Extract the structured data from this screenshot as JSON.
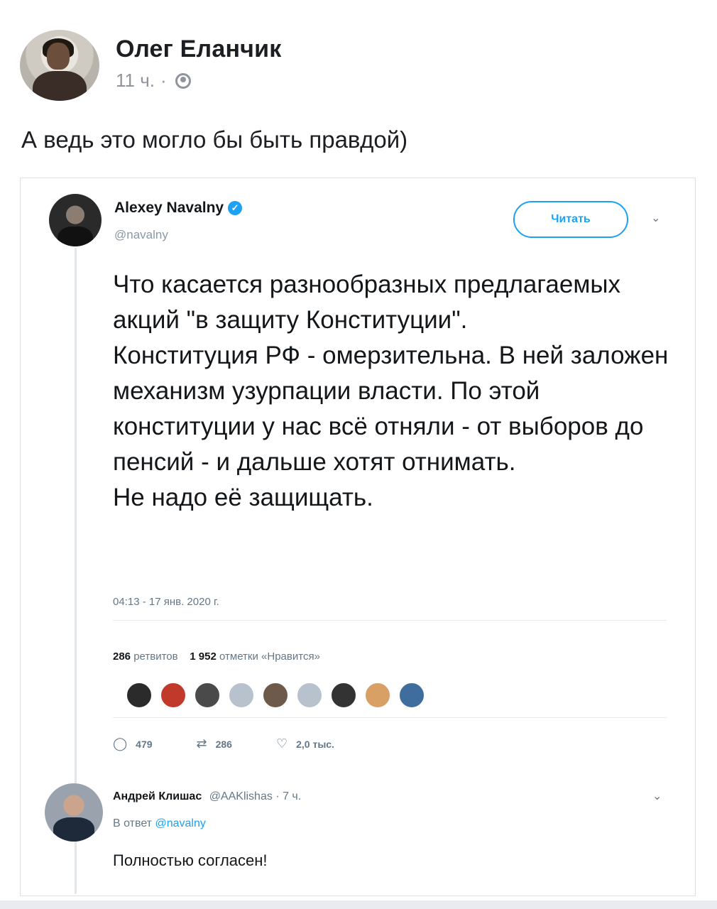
{
  "post": {
    "author": "Олег Еланчик",
    "time": "11 ч.",
    "separator": "·",
    "privacy_icon": "globe-icon",
    "text": "А ведь это могло бы быть правдой)"
  },
  "tweet": {
    "name": "Alexey Navalny",
    "verified_icon": "verified-badge-icon",
    "handle": "@navalny",
    "follow_label": "Читать",
    "caret": "⌄",
    "body": [
      "Что касается разнообразных предлагаемых акций \"в защиту Конституции\".",
      "Конституция РФ - омерзительна. В ней заложен механизм узурпации власти. По этой конституции у нас всё отняли - от выборов до пенсий - и дальше хотят отнимать.",
      "Не надо её защищать."
    ],
    "timestamp": "04:13 - 17 янв. 2020 г.",
    "retweets_count": "286",
    "retweets_label": "ретвитов",
    "likes_count": "1 952",
    "likes_label": "отметки «Нравится»",
    "actions": {
      "replies": "479",
      "retweets": "286",
      "likes": "2,0 тыс."
    }
  },
  "reply": {
    "name": "Андрей Клишас",
    "handle": "@AAKlishas",
    "time": "· 7 ч.",
    "in_reply_prefix": "В ответ",
    "in_reply_to": "@navalny",
    "text": "Полностью согласен!"
  },
  "colors": {
    "twitter_blue": "#1da1f2",
    "text_dark": "#14171a",
    "text_grey": "#657786"
  }
}
